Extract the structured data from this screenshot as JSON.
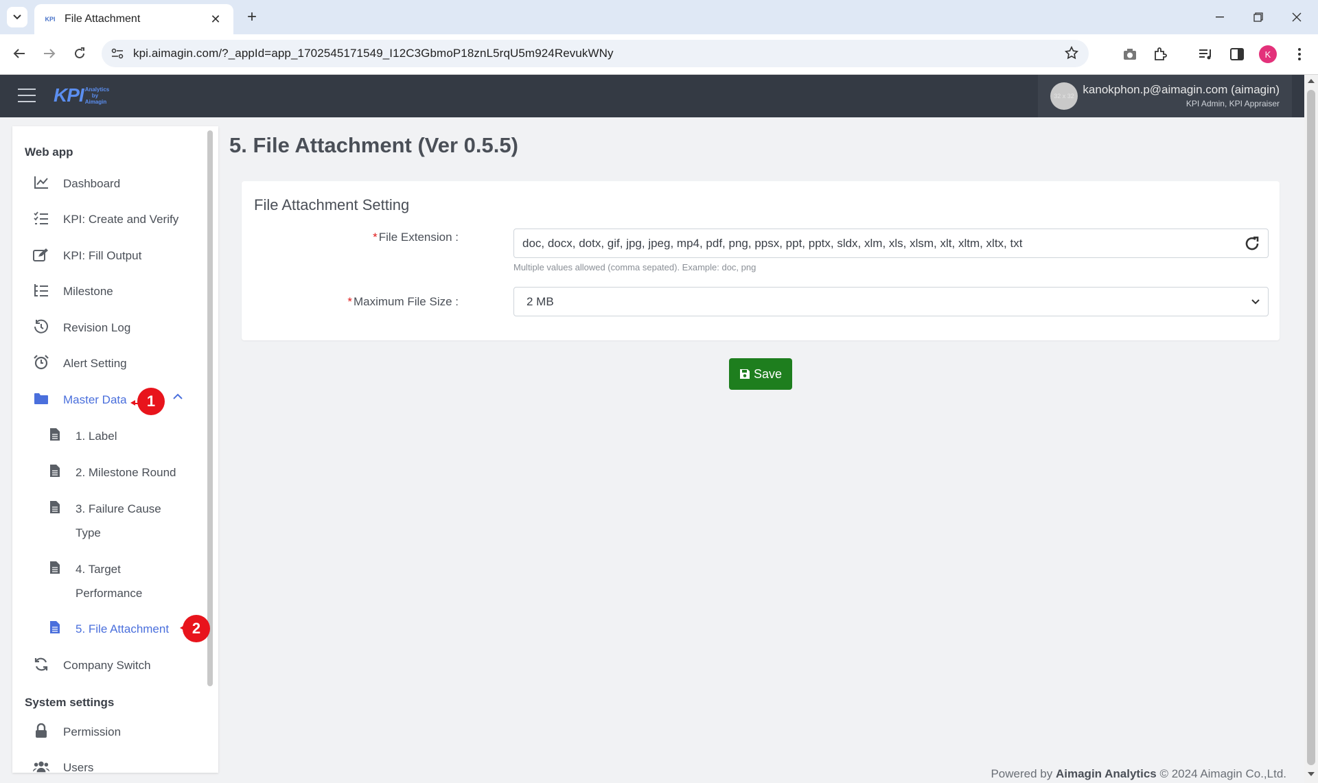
{
  "browser": {
    "tab_title": "File Attachment",
    "tab_favicon": "KPI",
    "url": "kpi.aimagin.com/?_appId=app_1702545171549_I12C3GbmoP18znL5rqU5m924RevukWNy",
    "profile_initial": "K"
  },
  "header": {
    "logo_main": "KPI",
    "logo_sub_1": "Analytics",
    "logo_sub_2": "by",
    "logo_sub_3": "Aimagin",
    "avatar_placeholder": "32 x 32",
    "user_name": "kanokphon.p@aimagin.com (aimagin)",
    "user_role": "KPI Admin, KPI Appraiser"
  },
  "sidebar": {
    "section_webapp": "Web app",
    "items": [
      {
        "label": "Dashboard",
        "icon": "chart-line-icon"
      },
      {
        "label": "KPI: Create and Verify",
        "icon": "checklist-icon"
      },
      {
        "label": "KPI: Fill Output",
        "icon": "edit-icon"
      },
      {
        "label": "Milestone",
        "icon": "task-list-icon"
      },
      {
        "label": "Revision Log",
        "icon": "history-icon"
      },
      {
        "label": "Alert Setting",
        "icon": "alarm-clock-icon"
      },
      {
        "label": "Master Data",
        "icon": "folder-icon"
      },
      {
        "label": "Company Switch",
        "icon": "sync-icon"
      }
    ],
    "master_sub": [
      {
        "label": "1. Label"
      },
      {
        "label": "2. Milestone Round"
      },
      {
        "label": "3. Failure Cause Type"
      },
      {
        "label": "4. Target Performance"
      },
      {
        "label": "5. File Attachment"
      }
    ],
    "section_system": "System settings",
    "system_items": [
      {
        "label": "Permission",
        "icon": "lock-icon"
      },
      {
        "label": "Users",
        "icon": "users-icon"
      }
    ],
    "markers": [
      "1",
      "2"
    ]
  },
  "main": {
    "page_title": "5. File Attachment (Ver 0.5.5)",
    "card_title": "File Attachment Setting",
    "ext_label": "File Extension :",
    "ext_value": "doc, docx, dotx, gif, jpg, jpeg, mp4, pdf, png, ppsx, ppt, pptx, sldx, xlm, xls, xlsm, xlt, xltm, xltx, txt",
    "ext_help": "Multiple values allowed (comma sepated). Example: doc, png",
    "size_label": "Maximum File Size :",
    "size_value": "2 MB",
    "required_mark": "*",
    "save_label": "Save"
  },
  "footer": {
    "prefix": "Powered by",
    "brand": "Aimagin Analytics",
    "suffix": "© 2024 Aimagin Co.,Ltd."
  },
  "colors": {
    "header_bg": "#343a44",
    "accent": "#4a6fdc",
    "save": "#1e7e1e",
    "marker": "#e8141c"
  }
}
